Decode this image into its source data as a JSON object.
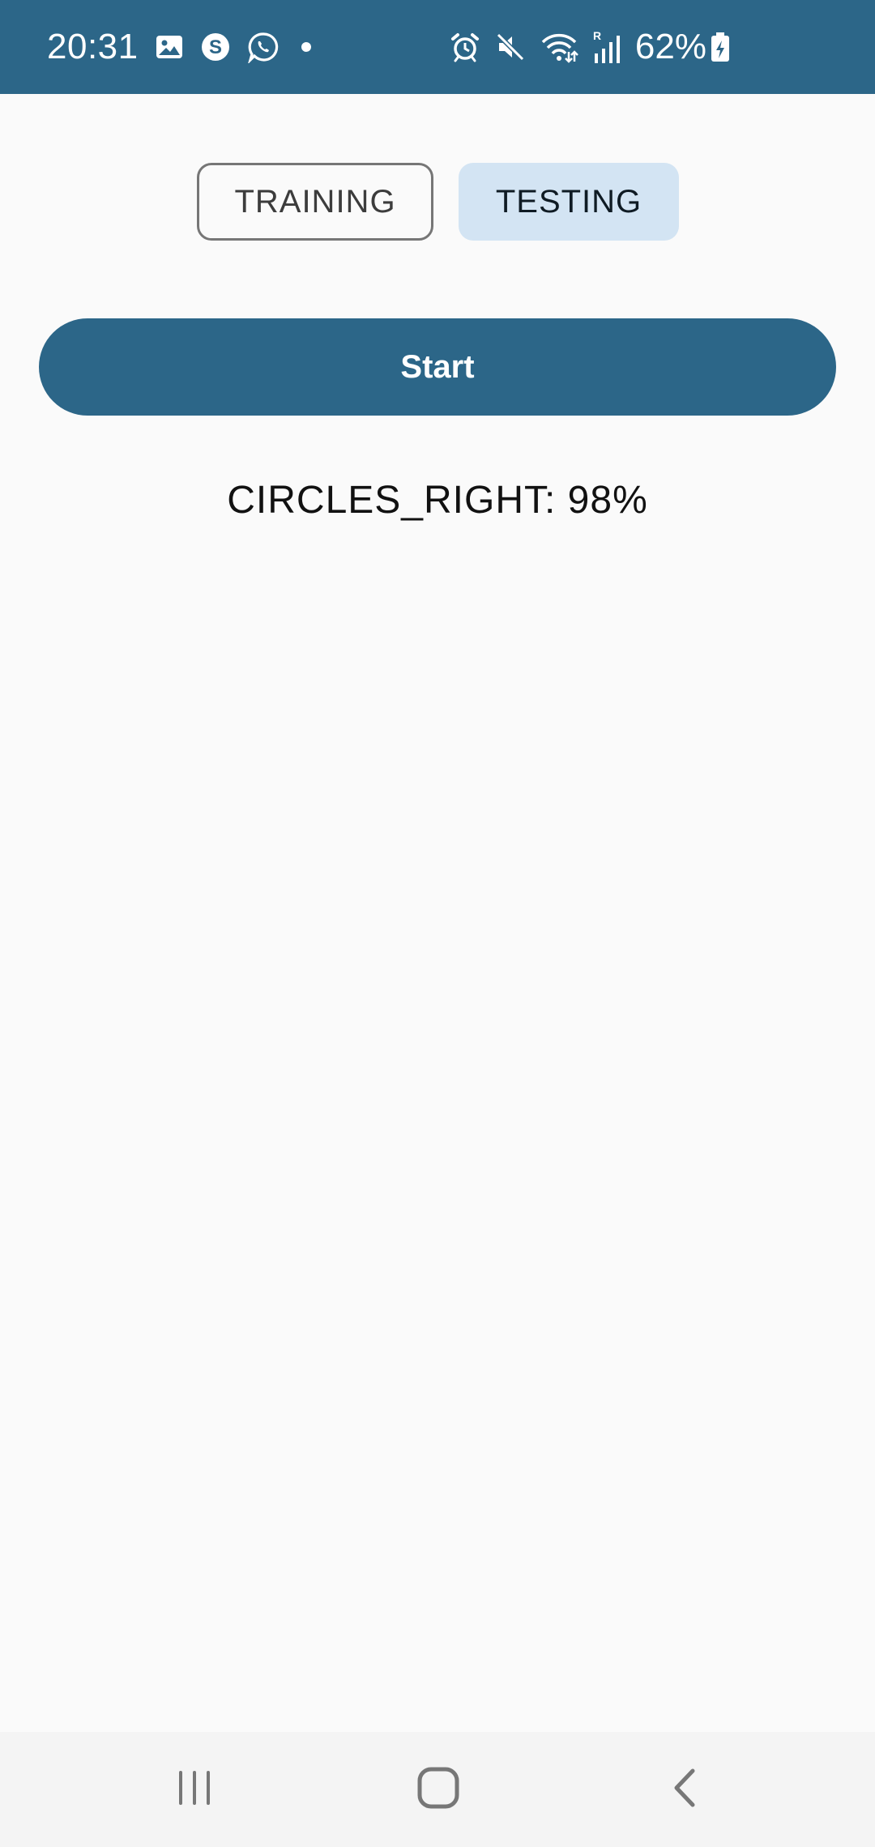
{
  "status_bar": {
    "time": "20:31",
    "battery_percent": "62%",
    "background_color": "#2c6688",
    "left_icons": [
      "gallery-icon",
      "skype-icon",
      "whatsapp-icon",
      "notification-dot-icon"
    ],
    "right_icons": [
      "alarm-icon",
      "mute-icon",
      "wifi-icon",
      "signal-icon",
      "battery-icon"
    ]
  },
  "mode_toggle": {
    "options": [
      {
        "label": "TRAINING",
        "selected": false
      },
      {
        "label": "TESTING",
        "selected": true
      }
    ]
  },
  "start_button": {
    "label": "Start",
    "color": "#2c6688"
  },
  "result": {
    "text": "CIRCLES_RIGHT: 98%"
  },
  "nav_bar": {
    "buttons": [
      "recent-apps-icon",
      "home-icon",
      "back-icon"
    ]
  }
}
